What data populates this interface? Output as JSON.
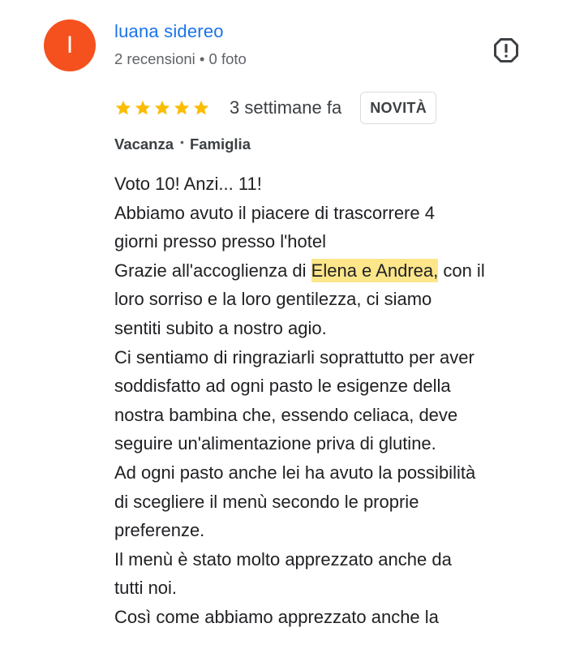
{
  "reviewer": {
    "initial": "I",
    "name": "luana sidereo",
    "meta": "2 recensioni • 0 foto",
    "avatar_color": "#f4511e"
  },
  "report_icon": "report-icon",
  "rating": {
    "stars": 5,
    "star_color": "#fbbc04",
    "time_ago": "3 settimane fa",
    "badge": "NOVITÀ"
  },
  "tags": {
    "trip_type": "Vacanza",
    "travel_group": "Famiglia"
  },
  "review": {
    "lines": [
      "Voto 10! Anzi... 11!",
      "Abbiamo avuto il piacere di trascorrere 4",
      "giorni presso presso l'hotel"
    ],
    "highlight_line": {
      "before": "Grazie all'accoglienza di ",
      "highlight": "Elena e Andrea,",
      "after": " con il"
    },
    "lines_after": [
      "loro sorriso e la loro gentilezza, ci siamo",
      "sentiti subito a nostro agio.",
      "Ci sentiamo di ringraziarli soprattutto per aver",
      "soddisfatto ad ogni pasto le esigenze della",
      "nostra bambina che, essendo celiaca, deve",
      "seguire un'alimentazione priva di glutine.",
      "Ad ogni pasto anche lei ha avuto la possibilità",
      "di scegliere il menù secondo le proprie",
      "preferenze.",
      "Il menù è stato molto apprezzato anche da",
      "tutti noi.",
      "Così come abbiamo apprezzato anche la"
    ],
    "highlight_color": "#fde68a"
  }
}
